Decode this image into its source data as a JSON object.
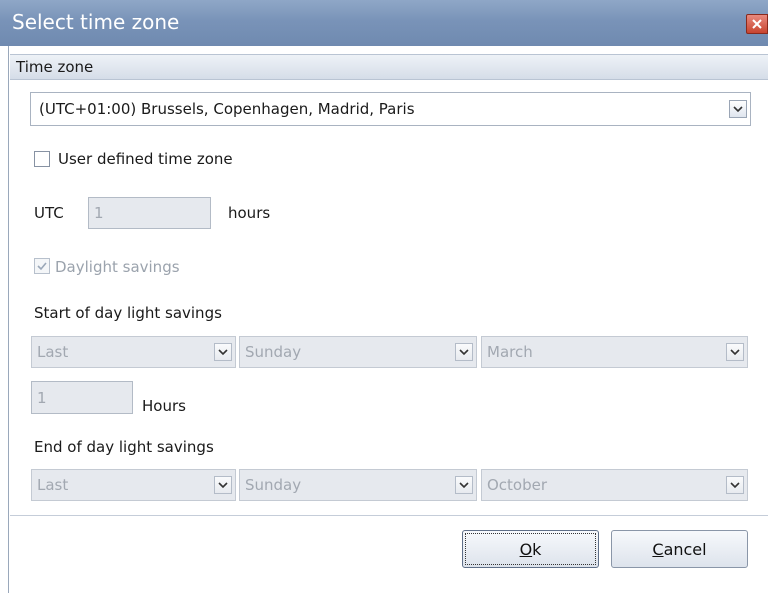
{
  "window": {
    "title": "Select time zone"
  },
  "group": {
    "header": "Time zone"
  },
  "timezone_select": {
    "value": "(UTC+01:00) Brussels, Copenhagen, Madrid, Paris"
  },
  "user_defined": {
    "label": "User defined time zone",
    "checked": false
  },
  "utc": {
    "prefix": "UTC",
    "value": "1",
    "suffix": "hours"
  },
  "daylight": {
    "label": "Daylight savings",
    "checked": true
  },
  "start_dst": {
    "heading": "Start of day light savings",
    "week": "Last",
    "day": "Sunday",
    "month": "March",
    "hours_value": "1",
    "hours_label": "Hours"
  },
  "end_dst": {
    "heading": "End of day light savings",
    "week": "Last",
    "day": "Sunday",
    "month": "October"
  },
  "buttons": {
    "ok_mnemonic": "O",
    "ok_rest": "k",
    "cancel_mnemonic": "C",
    "cancel_rest": "ancel"
  },
  "colors": {
    "titlebar": "#7993b8",
    "close": "#c8442f",
    "disabled_fill": "#e6e9ee"
  },
  "icons": [
    "close-icon",
    "chevron-down-icon",
    "checkmark-icon"
  ]
}
